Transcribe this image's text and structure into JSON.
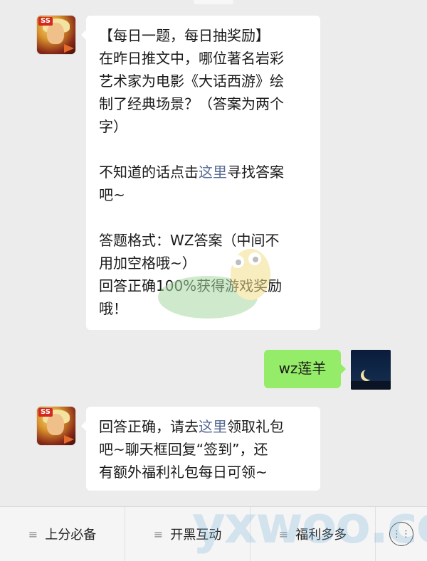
{
  "messages": [
    {
      "sender": "game",
      "lines": [
        "【每日一题，每日抽奖励】",
        "在昨日推文中，哪位著名岩彩",
        "艺术家为电影《大话西游》绘",
        "制了经典场景？（答案为两个",
        "字）",
        "",
        "不知道的话点击",
        "吧~",
        "",
        "答题格式：WZ答案（中间不",
        "用加空格哦~）",
        "回答正确100%获得游戏奖励",
        "哦！"
      ],
      "link_text": "这里",
      "after_link": "寻找答案"
    },
    {
      "sender": "user",
      "text": "wz莲羊"
    },
    {
      "sender": "game",
      "line1_pre": "回答正确，请去",
      "link_text": "这里",
      "line1_post": "领取礼包",
      "line2": "吧~聊天框回复“签到”，还",
      "line3": "有额外福利礼包每日可领~"
    }
  ],
  "avatar_badge": "SS",
  "bottom_menu": [
    {
      "label": "上分必备"
    },
    {
      "label": "开黑互动"
    },
    {
      "label": "福利多多"
    }
  ],
  "watermark": "yxwoo.com",
  "colors": {
    "bubble_user": "#95ec69",
    "link": "#576b95",
    "background": "#ececec"
  }
}
